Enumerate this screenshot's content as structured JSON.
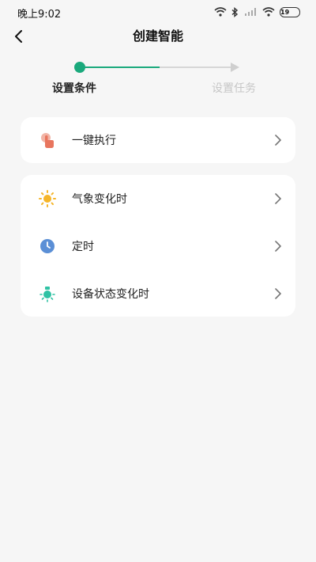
{
  "status_bar": {
    "time": "晚上9:02",
    "battery": "19",
    "icons": [
      "wifi-icon",
      "bluetooth-icon",
      "hd-signal-icon",
      "wifi-icon",
      "battery-icon"
    ]
  },
  "header": {
    "title": "创建智能",
    "back_icon": "chevron-left-icon"
  },
  "stepper": {
    "steps": [
      {
        "label": "设置条件",
        "active": true
      },
      {
        "label": "设置任务",
        "active": false
      }
    ],
    "colors": {
      "active": "#1aa97c",
      "inactive": "#cfcfcf"
    }
  },
  "cards": [
    {
      "items": [
        {
          "label": "一键执行",
          "icon": "hand-tap-icon",
          "icon_color": "#e8755e"
        }
      ]
    },
    {
      "items": [
        {
          "label": "气象变化时",
          "icon": "sun-icon",
          "icon_color": "#f5b52a"
        },
        {
          "label": "定时",
          "icon": "clock-icon",
          "icon_color": "#5b8fd6"
        },
        {
          "label": "设备状态变化时",
          "icon": "lamp-icon",
          "icon_color": "#2fc2a4"
        }
      ]
    }
  ]
}
